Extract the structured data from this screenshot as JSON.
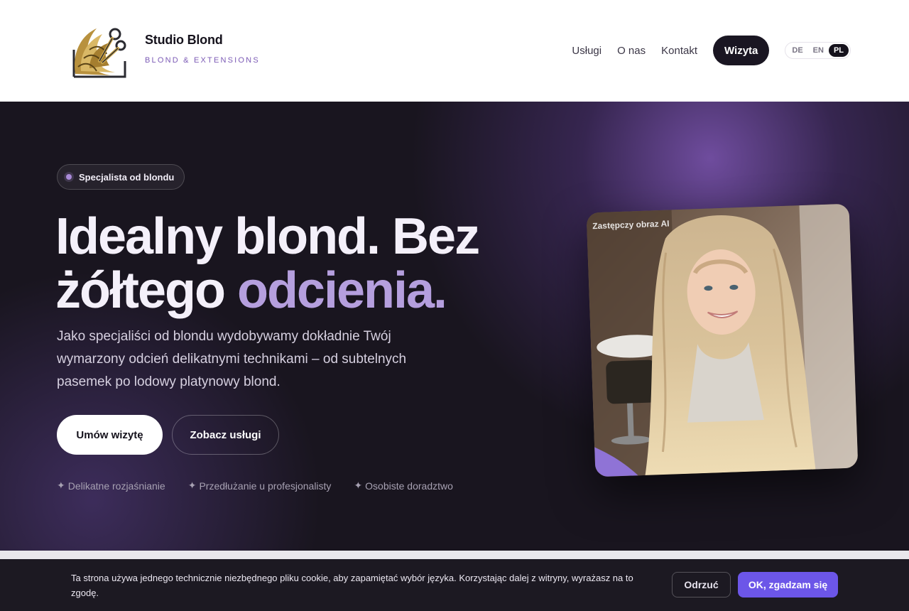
{
  "header": {
    "brand_name": "Studio Blond",
    "brand_tagline": "BLOND & EXTENSIONS",
    "logo_icon": "golden-hair-scissors-logo",
    "nav": [
      {
        "label": "Usługi"
      },
      {
        "label": "O nas"
      },
      {
        "label": "Kontakt"
      }
    ],
    "cta_label": "Wizyta",
    "languages": [
      {
        "code": "DE",
        "active": false
      },
      {
        "code": "EN",
        "active": false
      },
      {
        "code": "PL",
        "active": true
      }
    ]
  },
  "hero": {
    "badge": "Specjalista od blondu",
    "title_part1": "Idealny blond. Bez ",
    "title_part2": "żółtego ",
    "title_accent": "odcienia.",
    "lead": "Jako specjaliści od blondu wydobywamy dokładnie Twój wymarzony odcień delikatnymi technikami – od subtelnych pasemek po lodowy platynowy blond.",
    "primary_button": "Umów wizytę",
    "secondary_button": "Zobacz usługi",
    "features": [
      {
        "icon": "sparkle-icon",
        "glyph": "✦",
        "label": "Delikatne rozjaśnianie"
      },
      {
        "icon": "sparkle-icon",
        "glyph": "✦",
        "label": "Przedłużanie u profesjonalisty"
      },
      {
        "icon": "sparkle-icon",
        "glyph": "✦",
        "label": "Osobiste doradztwo"
      }
    ],
    "photo_caption": "Zastępczy obraz AI"
  },
  "cookie_banner": {
    "text": "Ta strona używa jednego technicznie niezbędnego pliku cookie, aby zapamiętać wybór języka. Korzystając dalej z witryny, wyrażasz na to zgodę.",
    "decline_label": "Odrzuć",
    "accept_label": "OK, zgadzam się"
  },
  "colors": {
    "hero_bg": "#19151f",
    "accent_purple": "#b59fde",
    "accept_button": "#6c56e8",
    "dark_button": "#1a1622"
  }
}
